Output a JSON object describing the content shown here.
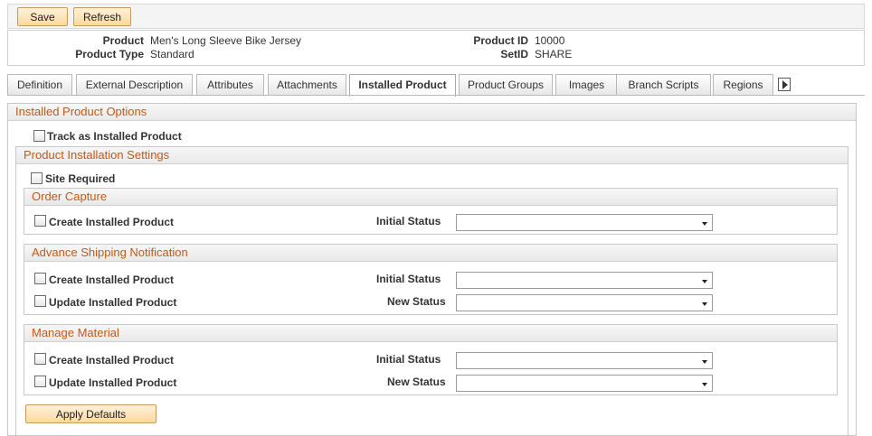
{
  "toolbar": {
    "save_label": "Save",
    "refresh_label": "Refresh"
  },
  "header": {
    "product_label": "Product",
    "product_value": "Men's Long Sleeve Bike Jersey",
    "product_type_label": "Product Type",
    "product_type_value": "Standard",
    "product_id_label": "Product ID",
    "product_id_value": "10000",
    "setid_label": "SetID",
    "setid_value": "SHARE"
  },
  "tabs": [
    {
      "label": "Definition"
    },
    {
      "label": "External Description"
    },
    {
      "label": "Attributes"
    },
    {
      "label": "Attachments"
    },
    {
      "label": "Installed Product"
    },
    {
      "label": "Product Groups"
    },
    {
      "label": "Images"
    },
    {
      "label": "Branch Scripts"
    },
    {
      "label": "Regions"
    }
  ],
  "active_tab": "Installed Product",
  "options": {
    "title": "Installed Product Options",
    "track_label": "Track as Installed Product",
    "track_checked": false
  },
  "settings": {
    "title": "Product Installation Settings",
    "site_required_label": "Site Required",
    "site_required_checked": false
  },
  "order_capture": {
    "title": "Order Capture",
    "create_label": "Create Installed Product",
    "initial_status_label": "Initial Status",
    "initial_status_value": ""
  },
  "asn": {
    "title": "Advance Shipping Notification",
    "create_label": "Create Installed Product",
    "initial_status_label": "Initial Status",
    "initial_status_value": "",
    "update_label": "Update Installed Product",
    "new_status_label": "New Status",
    "new_status_value": ""
  },
  "manage_material": {
    "title": "Manage Material",
    "create_label": "Create Installed Product",
    "initial_status_label": "Initial Status",
    "initial_status_value": "",
    "update_label": "Update Installed Product",
    "new_status_label": "New Status",
    "new_status_value": ""
  },
  "apply_defaults_label": "Apply Defaults",
  "colors": {
    "section_title": "#c25a17",
    "button_bg": "#fcd8a2",
    "button_border": "#c69b5c"
  }
}
